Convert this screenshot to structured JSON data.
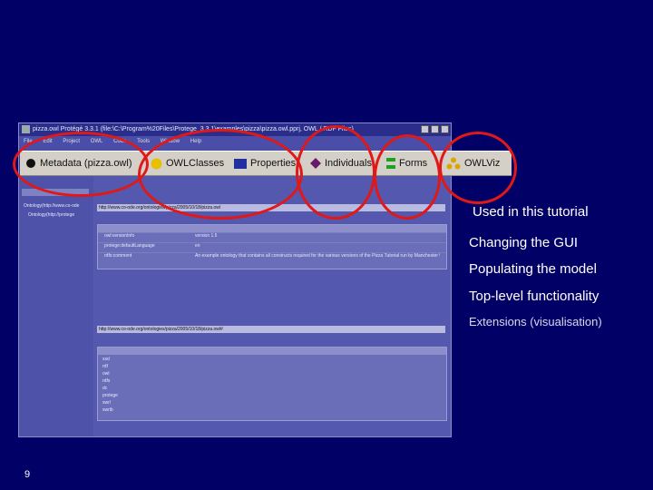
{
  "screenshot": {
    "title": "pizza.owl Protégé 3.3.1 (file:\\C:\\Program%20Files\\Protege_3.3.1\\examples\\pizza\\pizza.owl.pprj, OWL / RDF Files)",
    "menus": [
      "File",
      "Edit",
      "Project",
      "OWL",
      "Code",
      "Tools",
      "Window",
      "Help"
    ],
    "tabs": [
      {
        "label": "Metadata (pizza.owl)",
        "icon": "diamond-icon",
        "color": "#101010"
      },
      {
        "label": "OWLClasses",
        "icon": "circle-icon",
        "color": "#e8c000"
      },
      {
        "label": "Properties",
        "icon": "rect-icon",
        "color": "#2030a0"
      },
      {
        "label": "Individuals",
        "icon": "diamond-icon",
        "color": "#6a1a6a"
      },
      {
        "label": "Forms",
        "icon": "form-icon",
        "color": "#20a020"
      },
      {
        "label": "OWLViz",
        "icon": "tree-icon",
        "color": "#d8a800"
      }
    ],
    "left_items": [
      "Ontology(http://www.co-ode",
      "Ontology(http://protege"
    ],
    "ontology_uri": "http://www.co-ode.org/ontologies/pizza/2005/10/18/pizza.owl",
    "prop_rows": [
      "owl:versionInfo",
      "protege:defaultLanguage",
      "rdfs:comment"
    ],
    "prop_values": [
      "version 1.5",
      "en",
      "An example ontology that contains all constructs required for the various versions of the Pizza Tutorial run by Manchester University (see http://www.co-ode.org/resources/tutorials/)"
    ],
    "default_ns": "http://www.co-ode.org/ontologies/pizza/2005/10/18/pizza.owl#",
    "prefixes": [
      "xsd",
      "rdf",
      "owl",
      "rdfs",
      "dc",
      "protege",
      "swrl",
      "swrlb"
    ]
  },
  "bullets": [
    "Used in this tutorial",
    "Changing the GUI",
    "Populating the model",
    "Top-level functionality",
    "Extensions (visualisation)"
  ],
  "page_number": "9",
  "colors": {
    "background": "#000066",
    "highlight": "#e01818"
  }
}
